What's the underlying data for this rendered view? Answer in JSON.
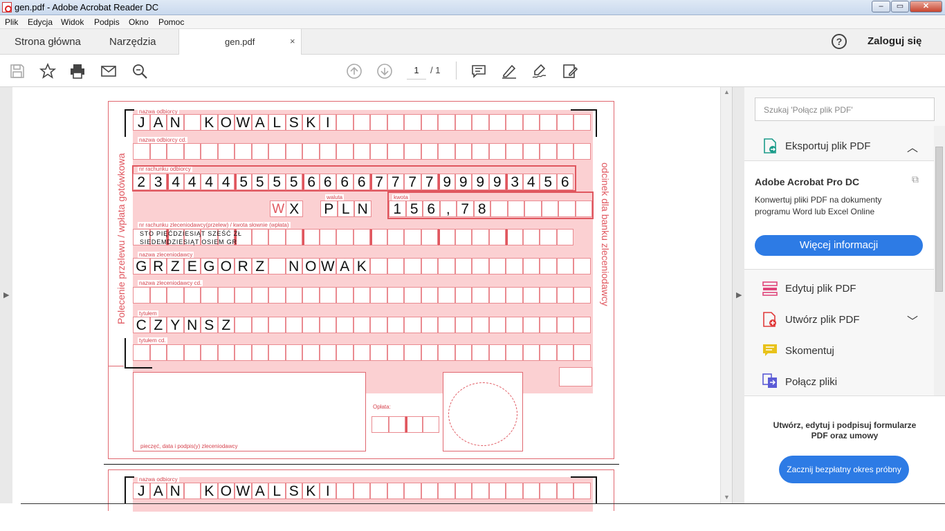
{
  "window": {
    "title": "gen.pdf - Adobe Acrobat Reader DC",
    "buttons": [
      "–",
      "▭",
      "✕"
    ]
  },
  "menu": [
    "Plik",
    "Edycja",
    "Widok",
    "Podpis",
    "Okno",
    "Pomoc"
  ],
  "tabs": {
    "home": "Strona główna",
    "tools": "Narzędzia",
    "document": "gen.pdf",
    "close": "×"
  },
  "header": {
    "help": "?",
    "login": "Zaloguj się"
  },
  "toolbar": {
    "icons": [
      "save-icon",
      "star-icon",
      "print-icon",
      "mail-icon",
      "zoom-icon",
      "page-up-icon",
      "page-down-icon",
      "comment-icon",
      "highlight-icon",
      "sign-icon",
      "fill-sign-icon"
    ],
    "page_current": "1",
    "page_total": "/ 1"
  },
  "form": {
    "labels": {
      "recipient": "nazwa odbiorcy",
      "recipient_cont": "nazwa odbiorcy cd.",
      "account": "nr rachunku odbiorcy",
      "currency": "waluta",
      "amount": "kwota",
      "payer_account": "nr rachunku zleceniodawcy(przelew) / kwota słownie (wpłata)",
      "payer": "nazwa zleceniodawcy",
      "payer_cont": "nazwa zleceniodawcy cd.",
      "title": "tytułem",
      "title_cont": "tytułem cd.",
      "stamp": "pieczęć, data i podpis(y) zleceniodawcy",
      "fee": "Opłata:",
      "side_left": "Polecenie przelewu / wpłata gotówkowa",
      "side_right": "odcinek dla banku zleceniodawcy"
    },
    "recipient": "JAN KOWALSKI",
    "account_number": "23444455556666777799993456",
    "type_w": "W",
    "type_x": "X",
    "currency": "PLN",
    "amount": "156,78",
    "amount_words_line1": "STO PIĘĆDZIESIĄT SZEŚĆ ZŁ",
    "amount_words_line2": "SIEDEMDZIESIĄT OSIEM GR",
    "payer": "GRZEGORZ NOWAK",
    "title": "CZYNSZ"
  },
  "panel": {
    "search_placeholder": "Szukaj 'Połącz plik PDF'",
    "export_label": "Eksportuj plik PDF",
    "product_title": "Adobe Acrobat Pro DC",
    "product_desc": "Konwertuj pliki PDF na dokumenty programu Word lub Excel Online",
    "more_info": "Więcej informacji",
    "tools": [
      {
        "label": "Edytuj plik PDF",
        "icon": "edit-pdf-icon",
        "color": "#e0467c"
      },
      {
        "label": "Utwórz plik PDF",
        "icon": "create-pdf-icon",
        "color": "#e03a3a"
      },
      {
        "label": "Skomentuj",
        "icon": "comment-tool-icon",
        "color": "#e8c21a"
      },
      {
        "label": "Połącz pliki",
        "icon": "combine-icon",
        "color": "#5b5bd6"
      }
    ],
    "promo_text": "Utwórz, edytuj i podpisuj formularze PDF oraz umowy",
    "trial_button": "Zacznij bezpłatny okres próbny"
  },
  "colors": {
    "accent": "#2d7be5",
    "form_red": "#e0575f",
    "form_pink": "#fbd0d2"
  }
}
